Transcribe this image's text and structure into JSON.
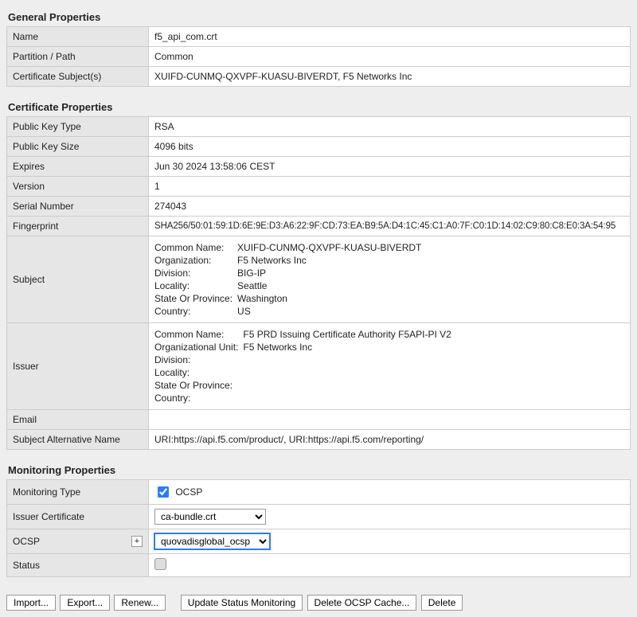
{
  "sections": {
    "general": "General Properties",
    "cert": "Certificate Properties",
    "mon": "Monitoring Properties"
  },
  "general": {
    "name_label": "Name",
    "name_value": "f5_api_com.crt",
    "partition_label": "Partition / Path",
    "partition_value": "Common",
    "subjects_label": "Certificate Subject(s)",
    "subjects_value": "XUIFD-CUNMQ-QXVPF-KUASU-BIVERDT, F5 Networks Inc"
  },
  "cert": {
    "pkt_label": "Public Key Type",
    "pkt_value": "RSA",
    "pks_label": "Public Key Size",
    "pks_value": "4096 bits",
    "exp_label": "Expires",
    "exp_value": "Jun 30 2024 13:58:06 CEST",
    "ver_label": "Version",
    "ver_value": "1",
    "sn_label": "Serial Number",
    "sn_value": "274043",
    "fp_label": "Fingerprint",
    "fp_value": "SHA256/50:01:59:1D:6E:9E:D3:A6:22:9F:CD:73:EA:B9:5A:D4:1C:45:C1:A0:7F:C0:1D:14:02:C9:80:C8:E0:3A:54:95",
    "subject_label": "Subject",
    "subject": {
      "cn_k": "Common Name:",
      "cn_v": "XUIFD-CUNMQ-QXVPF-KUASU-BIVERDT",
      "org_k": "Organization:",
      "org_v": "F5 Networks Inc",
      "div_k": "Division:",
      "div_v": "BIG-IP",
      "loc_k": "Locality:",
      "loc_v": "Seattle",
      "sop_k": "State Or Province:",
      "sop_v": "Washington",
      "cty_k": "Country:",
      "cty_v": "US"
    },
    "issuer_label": "Issuer",
    "issuer": {
      "cn_k": "Common Name:",
      "cn_v": "F5 PRD Issuing Certificate Authority F5API-PI V2",
      "ou_k": "Organizational Unit:",
      "ou_v": "F5 Networks Inc",
      "div_k": "Division:",
      "div_v": "",
      "loc_k": "Locality:",
      "loc_v": "",
      "sop_k": "State Or Province:",
      "sop_v": "",
      "cty_k": "Country:",
      "cty_v": ""
    },
    "email_label": "Email",
    "email_value": "",
    "san_label": "Subject Alternative Name",
    "san_value": "URI:https://api.f5.com/product/, URI:https://api.f5.com/reporting/"
  },
  "mon": {
    "type_label": "Monitoring Type",
    "type_check_label": "OCSP",
    "issuer_label": "Issuer Certificate",
    "issuer_selected": "ca-bundle.crt",
    "ocsp_label": "OCSP",
    "ocsp_selected": "quovadisglobal_ocsp",
    "status_label": "Status"
  },
  "buttons": {
    "import": "Import...",
    "export": "Export...",
    "renew": "Renew...",
    "update": "Update Status Monitoring",
    "delcache": "Delete OCSP Cache...",
    "delete": "Delete"
  }
}
